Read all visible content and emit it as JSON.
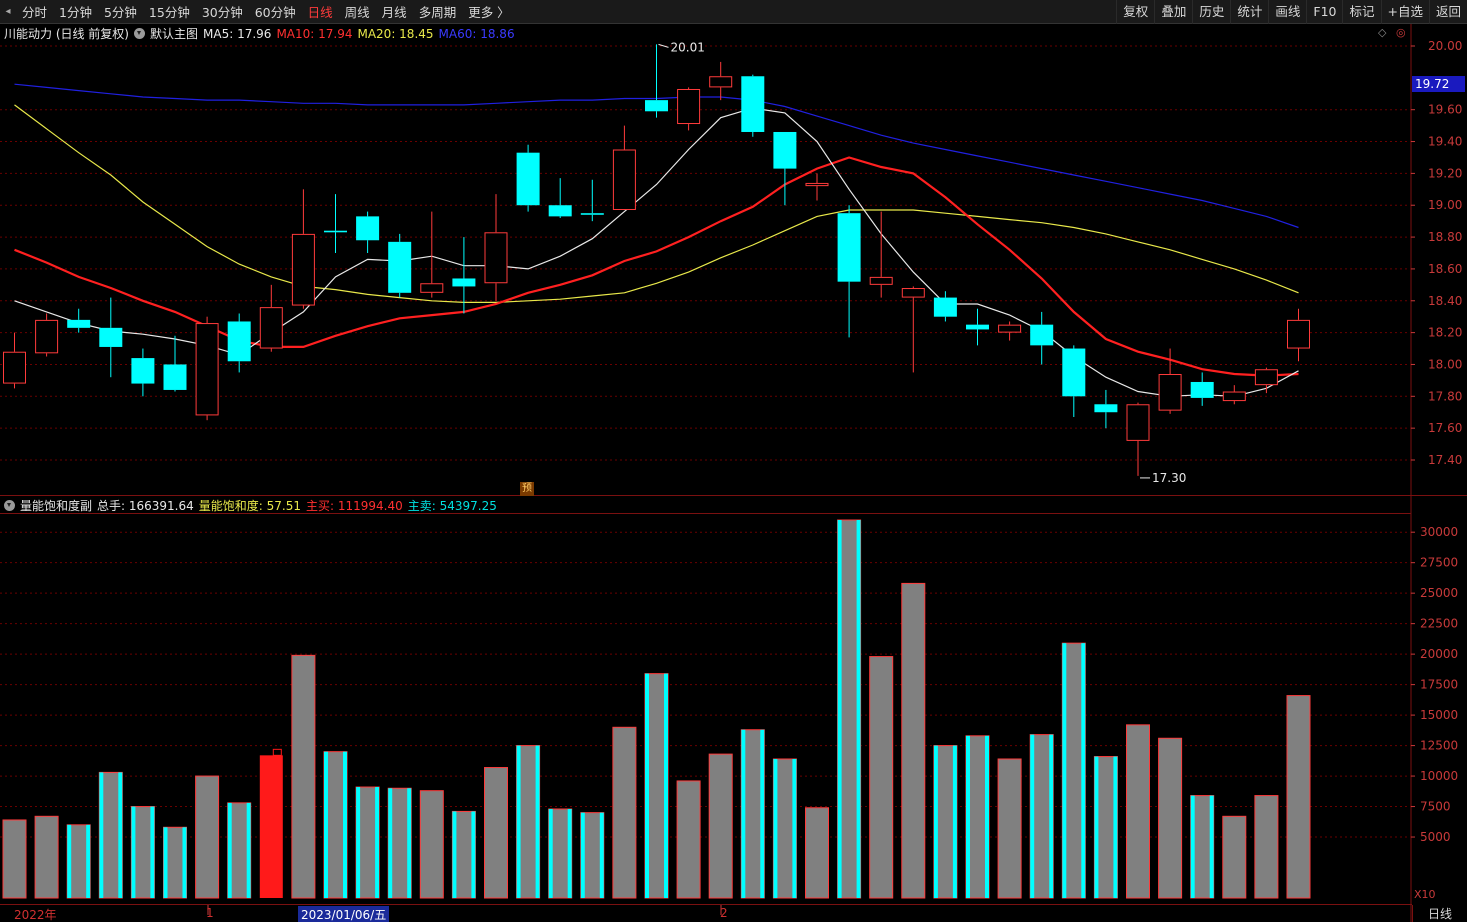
{
  "toolbar": {
    "periods": [
      "分时",
      "1分钟",
      "5分钟",
      "15分钟",
      "30分钟",
      "60分钟",
      "日线",
      "周线",
      "月线",
      "多周期",
      "更多 〉"
    ],
    "active_period": "日线",
    "tools": [
      "复权",
      "叠加",
      "历史",
      "统计",
      "画线",
      "F10",
      "标记",
      "+自选",
      "返回"
    ]
  },
  "main_legend": {
    "stock": "川能动力 (日线 前复权)",
    "template": "默认主图",
    "ma5": "MA5: 17.96",
    "ma10": "MA10: 17.94",
    "ma20": "MA20: 18.45",
    "ma60": "MA60: 18.86"
  },
  "sub_legend": {
    "name": "量能饱和度副",
    "total": "总手: 166391.64",
    "saturation": "量能饱和度: 57.51",
    "buy": "主买: 111994.40",
    "sell": "主卖: 54397.25"
  },
  "annotations": {
    "high": "20.01",
    "low": "17.30",
    "yu": "预"
  },
  "current_price": "19.72",
  "period_tag": "日线",
  "x10": "X10",
  "dates": {
    "year": "2022年",
    "m1": "1",
    "current": "2023/01/06/五",
    "m2": "2"
  },
  "colors": {
    "bg": "#000000",
    "up": "#ff3b3b",
    "down": "#00ffff",
    "ma5": "#e8e8e8",
    "ma10": "#ff2020",
    "ma20": "#e8e84a",
    "ma60": "#2020e0",
    "grid": "#6a0000"
  },
  "chart_data": [
    {
      "type": "candlestick",
      "title": "川能动力 (日线 前复权)",
      "ylim": [
        17.2,
        20.1
      ],
      "yticks": [
        17.4,
        17.6,
        17.8,
        18.0,
        18.2,
        18.4,
        18.6,
        18.8,
        19.0,
        19.2,
        19.4,
        19.6,
        20.0
      ],
      "candles": [
        {
          "o": 17.88,
          "h": 18.2,
          "l": 17.85,
          "c": 18.08
        },
        {
          "o": 18.07,
          "h": 18.32,
          "l": 18.05,
          "c": 18.28
        },
        {
          "o": 18.28,
          "h": 18.35,
          "l": 18.2,
          "c": 18.23
        },
        {
          "o": 18.23,
          "h": 18.42,
          "l": 17.92,
          "c": 18.11
        },
        {
          "o": 18.04,
          "h": 18.1,
          "l": 17.8,
          "c": 17.88
        },
        {
          "o": 18.0,
          "h": 18.18,
          "l": 17.83,
          "c": 17.84
        },
        {
          "o": 17.68,
          "h": 18.3,
          "l": 17.65,
          "c": 18.26
        },
        {
          "o": 18.27,
          "h": 18.32,
          "l": 17.95,
          "c": 18.02
        },
        {
          "o": 18.1,
          "h": 18.5,
          "l": 18.08,
          "c": 18.36
        },
        {
          "o": 18.37,
          "h": 19.1,
          "l": 18.35,
          "c": 18.82
        },
        {
          "o": 18.84,
          "h": 19.07,
          "l": 18.7,
          "c": 18.83
        },
        {
          "o": 18.93,
          "h": 18.96,
          "l": 18.7,
          "c": 18.78
        },
        {
          "o": 18.77,
          "h": 18.82,
          "l": 18.42,
          "c": 18.45
        },
        {
          "o": 18.45,
          "h": 18.96,
          "l": 18.42,
          "c": 18.51
        },
        {
          "o": 18.54,
          "h": 18.8,
          "l": 18.32,
          "c": 18.49
        },
        {
          "o": 18.51,
          "h": 19.07,
          "l": 18.4,
          "c": 18.83
        },
        {
          "o": 19.33,
          "h": 19.38,
          "l": 18.96,
          "c": 19.0
        },
        {
          "o": 19.0,
          "h": 19.17,
          "l": 18.92,
          "c": 18.93
        },
        {
          "o": 18.95,
          "h": 19.16,
          "l": 18.9,
          "c": 18.94
        },
        {
          "o": 18.97,
          "h": 19.5,
          "l": 18.97,
          "c": 19.35
        },
        {
          "o": 19.66,
          "h": 20.01,
          "l": 19.55,
          "c": 19.59
        },
        {
          "o": 19.51,
          "h": 19.74,
          "l": 19.47,
          "c": 19.73
        },
        {
          "o": 19.74,
          "h": 19.9,
          "l": 19.66,
          "c": 19.81
        },
        {
          "o": 19.81,
          "h": 19.82,
          "l": 19.43,
          "c": 19.46
        },
        {
          "o": 19.46,
          "h": 19.46,
          "l": 19.0,
          "c": 19.23
        },
        {
          "o": 19.12,
          "h": 19.2,
          "l": 19.03,
          "c": 19.14
        },
        {
          "o": 18.95,
          "h": 19.0,
          "l": 18.17,
          "c": 18.52
        },
        {
          "o": 18.5,
          "h": 18.96,
          "l": 18.42,
          "c": 18.55
        },
        {
          "o": 18.42,
          "h": 18.49,
          "l": 17.95,
          "c": 18.48
        },
        {
          "o": 18.42,
          "h": 18.46,
          "l": 18.27,
          "c": 18.3
        },
        {
          "o": 18.25,
          "h": 18.35,
          "l": 18.12,
          "c": 18.22
        },
        {
          "o": 18.2,
          "h": 18.27,
          "l": 18.15,
          "c": 18.25
        },
        {
          "o": 18.25,
          "h": 18.33,
          "l": 18.0,
          "c": 18.12
        },
        {
          "o": 18.1,
          "h": 18.12,
          "l": 17.67,
          "c": 17.8
        },
        {
          "o": 17.75,
          "h": 17.84,
          "l": 17.6,
          "c": 17.7
        },
        {
          "o": 17.52,
          "h": 17.76,
          "l": 17.3,
          "c": 17.75
        },
        {
          "o": 17.71,
          "h": 18.1,
          "l": 17.69,
          "c": 17.94
        },
        {
          "o": 17.89,
          "h": 17.95,
          "l": 17.74,
          "c": 17.79
        },
        {
          "o": 17.77,
          "h": 17.87,
          "l": 17.75,
          "c": 17.83
        },
        {
          "o": 17.87,
          "h": 17.98,
          "l": 17.82,
          "c": 17.97
        },
        {
          "o": 18.1,
          "h": 18.35,
          "l": 18.02,
          "c": 18.28
        }
      ],
      "ma5": [
        18.4,
        18.33,
        18.26,
        18.21,
        18.19,
        18.16,
        18.12,
        18.06,
        18.2,
        18.33,
        18.55,
        18.66,
        18.65,
        18.68,
        18.62,
        18.62,
        18.6,
        18.68,
        18.79,
        18.96,
        19.13,
        19.35,
        19.55,
        19.61,
        19.58,
        19.4,
        19.1,
        18.82,
        18.58,
        18.38,
        18.38,
        18.31,
        18.21,
        18.05,
        17.92,
        17.83,
        17.8,
        17.81,
        17.8,
        17.85,
        17.96
      ],
      "ma10": [
        18.72,
        18.64,
        18.55,
        18.48,
        18.4,
        18.33,
        18.24,
        18.15,
        18.11,
        18.11,
        18.18,
        18.24,
        18.29,
        18.31,
        18.33,
        18.38,
        18.45,
        18.5,
        18.56,
        18.65,
        18.71,
        18.8,
        18.9,
        18.99,
        19.13,
        19.23,
        19.3,
        19.24,
        19.2,
        19.05,
        18.88,
        18.72,
        18.54,
        18.33,
        18.16,
        18.08,
        18.03,
        17.97,
        17.94,
        17.93,
        17.94
      ],
      "ma20": [
        18.6,
        18.35,
        18.4,
        18.38
      ],
      "ma20_x": [
        0,
        11,
        14,
        15
      ],
      "ma20_full": [
        19.63,
        19.48,
        19.33,
        19.19,
        19.02,
        18.88,
        18.74,
        18.63,
        18.55,
        18.49,
        18.47,
        18.44,
        18.42,
        18.4,
        18.39,
        18.39,
        18.4,
        18.41,
        18.43,
        18.45,
        18.51,
        18.58,
        18.67,
        18.75,
        18.84,
        18.93,
        18.97,
        18.97,
        18.97,
        18.95,
        18.93,
        18.91,
        18.89,
        18.86,
        18.82,
        18.77,
        18.72,
        18.66,
        18.6,
        18.53,
        18.45
      ],
      "ma60": [
        19.76,
        19.74,
        19.72,
        19.7,
        19.68,
        19.67,
        19.66,
        19.66,
        19.65,
        19.64,
        19.64,
        19.63,
        19.63,
        19.63,
        19.63,
        19.64,
        19.65,
        19.66,
        19.66,
        19.67,
        19.67,
        19.68,
        19.68,
        19.66,
        19.62,
        19.56,
        19.5,
        19.44,
        19.39,
        19.35,
        19.31,
        19.27,
        19.23,
        19.19,
        19.15,
        19.11,
        19.07,
        19.03,
        18.98,
        18.93,
        18.86
      ]
    },
    {
      "type": "bar",
      "title": "量能饱和度副",
      "ylim": [
        0,
        31500
      ],
      "yticks": [
        5000,
        7500,
        10000,
        12500,
        15000,
        17500,
        20000,
        22500,
        25000,
        27500,
        30000
      ],
      "values": [
        6400,
        6700,
        6000,
        10300,
        7500,
        5800,
        10000,
        7800,
        11700,
        19900,
        12000,
        9100,
        9000,
        8800,
        7100,
        10700,
        12500,
        7300,
        7000,
        14000,
        18400,
        9600,
        11800,
        13800,
        11400,
        7400,
        31000,
        19800,
        25800,
        12500,
        13300,
        11400,
        13400,
        20900,
        11600,
        14200,
        13100,
        8400,
        6700,
        8400,
        16600
      ],
      "highlighted_index": 8
    }
  ]
}
